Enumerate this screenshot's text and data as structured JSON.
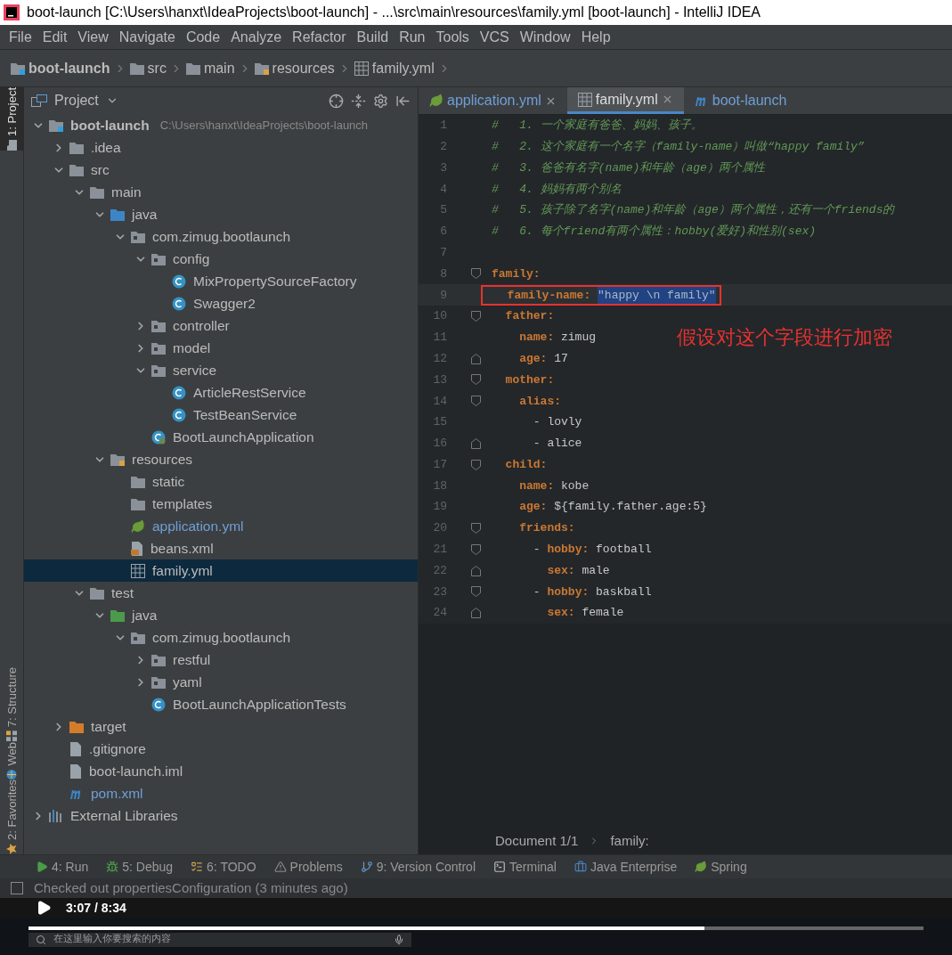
{
  "window": {
    "title": "boot-launch [C:\\Users\\hanxt\\IdeaProjects\\boot-launch] - ...\\src\\main\\resources\\family.yml [boot-launch] - IntelliJ IDEA"
  },
  "menu": [
    "File",
    "Edit",
    "View",
    "Navigate",
    "Code",
    "Analyze",
    "Refactor",
    "Build",
    "Run",
    "Tools",
    "VCS",
    "Window",
    "Help"
  ],
  "breadcrumbs": [
    {
      "label": "boot-launch",
      "kind": "module"
    },
    {
      "label": "src",
      "kind": "folder"
    },
    {
      "label": "main",
      "kind": "folder"
    },
    {
      "label": "resources",
      "kind": "resources"
    },
    {
      "label": "family.yml",
      "kind": "yml"
    }
  ],
  "tool_stripe": [
    {
      "label": "1: Project",
      "selected": true,
      "kind": "project"
    },
    {
      "label": "7: Structure",
      "selected": false,
      "kind": "structure"
    },
    {
      "label": "Web",
      "selected": false,
      "kind": "web"
    },
    {
      "label": "2: Favorites",
      "selected": false,
      "kind": "favorites"
    }
  ],
  "project_panel": {
    "title": "Project",
    "tree": [
      {
        "label": "boot-launch",
        "kind": "module",
        "path": "C:\\Users\\hanxt\\IdeaProjects\\boot-launch",
        "expanded": true,
        "selected": false,
        "children": [
          {
            "label": ".idea",
            "kind": "folder",
            "expanded": false,
            "selected": false
          },
          {
            "label": "src",
            "kind": "folder",
            "expanded": true,
            "selected": false,
            "children": [
              {
                "label": "main",
                "kind": "folder",
                "expanded": true,
                "selected": false,
                "children": [
                  {
                    "label": "java",
                    "kind": "source",
                    "expanded": true,
                    "selected": false,
                    "children": [
                      {
                        "label": "com.zimug.bootlaunch",
                        "kind": "package",
                        "expanded": true,
                        "selected": false,
                        "children": [
                          {
                            "label": "config",
                            "kind": "package",
                            "expanded": true,
                            "selected": false,
                            "children": [
                              {
                                "label": "MixPropertySourceFactory",
                                "kind": "class",
                                "selected": false
                              },
                              {
                                "label": "Swagger2",
                                "kind": "class",
                                "selected": false
                              }
                            ]
                          },
                          {
                            "label": "controller",
                            "kind": "package",
                            "expanded": false,
                            "selected": false
                          },
                          {
                            "label": "model",
                            "kind": "package",
                            "expanded": false,
                            "selected": false
                          },
                          {
                            "label": "service",
                            "kind": "package",
                            "expanded": true,
                            "selected": false,
                            "children": [
                              {
                                "label": "ArticleRestService",
                                "kind": "class",
                                "selected": false
                              },
                              {
                                "label": "TestBeanService",
                                "kind": "class",
                                "selected": false
                              }
                            ]
                          },
                          {
                            "label": "BootLaunchApplication",
                            "kind": "spring_class",
                            "selected": false
                          }
                        ]
                      }
                    ]
                  },
                  {
                    "label": "resources",
                    "kind": "resources",
                    "expanded": true,
                    "selected": false,
                    "children": [
                      {
                        "label": "static",
                        "kind": "folder",
                        "selected": false
                      },
                      {
                        "label": "templates",
                        "kind": "folder",
                        "selected": false
                      },
                      {
                        "label": "application.yml",
                        "kind": "spring_yml",
                        "modified": true,
                        "selected": false
                      },
                      {
                        "label": "beans.xml",
                        "kind": "xml",
                        "selected": false
                      },
                      {
                        "label": "family.yml",
                        "kind": "yml",
                        "selected": true
                      }
                    ]
                  }
                ]
              },
              {
                "label": "test",
                "kind": "folder",
                "expanded": true,
                "selected": false,
                "children": [
                  {
                    "label": "java",
                    "kind": "test_source",
                    "expanded": true,
                    "selected": false,
                    "children": [
                      {
                        "label": "com.zimug.bootlaunch",
                        "kind": "package",
                        "expanded": true,
                        "selected": false,
                        "children": [
                          {
                            "label": "restful",
                            "kind": "package",
                            "expanded": false,
                            "selected": false
                          },
                          {
                            "label": "yaml",
                            "kind": "package",
                            "expanded": false,
                            "selected": false
                          },
                          {
                            "label": "BootLaunchApplicationTests",
                            "kind": "class",
                            "selected": false
                          }
                        ]
                      }
                    ]
                  }
                ]
              }
            ]
          },
          {
            "label": "target",
            "kind": "excluded",
            "expanded": false,
            "selected": false
          },
          {
            "label": ".gitignore",
            "kind": "file",
            "selected": false
          },
          {
            "label": "boot-launch.iml",
            "kind": "file",
            "selected": false
          },
          {
            "label": "pom.xml",
            "kind": "maven",
            "modified": true,
            "selected": false
          }
        ]
      },
      {
        "label": "External Libraries",
        "kind": "library",
        "expanded": false,
        "selected": false
      }
    ]
  },
  "tabs": [
    {
      "label": "application.yml",
      "kind": "spring_yml",
      "selected": false,
      "closable": true
    },
    {
      "label": "family.yml",
      "kind": "yml",
      "selected": true,
      "closable": true
    },
    {
      "label": "boot-launch",
      "kind": "maven",
      "selected": false,
      "closable": false
    }
  ],
  "editor": {
    "lines": [
      {
        "number": "1",
        "boxed": false,
        "tokens": [
          {
            "kind": "comment",
            "text": "#   1. 一个家庭有爸爸、妈妈、孩子。"
          }
        ]
      },
      {
        "number": "2",
        "boxed": false,
        "tokens": [
          {
            "kind": "comment",
            "text": "#   2. 这个家庭有一个名字（family-name）叫做“happy family”"
          }
        ]
      },
      {
        "number": "3",
        "boxed": false,
        "tokens": [
          {
            "kind": "comment",
            "text": "#   3. 爸爸有名字(name)和年龄（age）两个属性"
          }
        ]
      },
      {
        "number": "4",
        "boxed": false,
        "tokens": [
          {
            "kind": "comment",
            "text": "#   4. 妈妈有两个别名"
          }
        ]
      },
      {
        "number": "5",
        "boxed": false,
        "tokens": [
          {
            "kind": "comment",
            "text": "#   5. 孩子除了名字(name)和年龄（age）两个属性，还有一个friends的"
          }
        ]
      },
      {
        "number": "6",
        "boxed": false,
        "tokens": [
          {
            "kind": "comment",
            "text": "#   6. 每个friend有两个属性：hobby(爱好)和性别(sex)"
          }
        ]
      },
      {
        "number": "7",
        "boxed": false
      },
      {
        "number": "8",
        "boxed": false,
        "kind": "fold_start",
        "tokens": [
          {
            "kind": "key",
            "text": "family:"
          }
        ]
      },
      {
        "number": "9",
        "boxed": true,
        "tokens": [
          {
            "kind": "key",
            "text": "  family-name: "
          },
          {
            "kind": "selection",
            "text": "\"happy \\n family\""
          }
        ]
      },
      {
        "number": "10",
        "boxed": false,
        "kind": "fold_start",
        "tokens": [
          {
            "kind": "key",
            "text": "  father:"
          }
        ]
      },
      {
        "number": "11",
        "boxed": false,
        "tokens": [
          {
            "kind": "key",
            "text": "    name: "
          },
          {
            "kind": "value",
            "text": "zimug"
          }
        ]
      },
      {
        "number": "12",
        "boxed": false,
        "kind": "fold_end",
        "tokens": [
          {
            "kind": "key",
            "text": "    age: "
          },
          {
            "kind": "value",
            "text": "17"
          }
        ]
      },
      {
        "number": "13",
        "boxed": false,
        "kind": "fold_start",
        "tokens": [
          {
            "kind": "key",
            "text": "  mother:"
          }
        ]
      },
      {
        "number": "14",
        "boxed": false,
        "kind": "fold_start",
        "tokens": [
          {
            "kind": "key",
            "text": "    alias:"
          }
        ]
      },
      {
        "number": "15",
        "boxed": false,
        "tokens": [
          {
            "kind": "value",
            "text": "      - lovly"
          }
        ]
      },
      {
        "number": "16",
        "boxed": false,
        "kind": "fold_end",
        "tokens": [
          {
            "kind": "value",
            "text": "      - alice"
          }
        ]
      },
      {
        "number": "17",
        "boxed": false,
        "kind": "fold_start",
        "tokens": [
          {
            "kind": "key",
            "text": "  child:"
          }
        ]
      },
      {
        "number": "18",
        "boxed": false,
        "tokens": [
          {
            "kind": "key",
            "text": "    name: "
          },
          {
            "kind": "value",
            "text": "kobe"
          }
        ]
      },
      {
        "number": "19",
        "boxed": false,
        "tokens": [
          {
            "kind": "key",
            "text": "    age: "
          },
          {
            "kind": "value",
            "text": "${family.father.age:5}"
          }
        ]
      },
      {
        "number": "20",
        "boxed": false,
        "kind": "fold_start",
        "tokens": [
          {
            "kind": "key",
            "text": "    friends:"
          }
        ]
      },
      {
        "number": "21",
        "boxed": false,
        "kind": "fold_start",
        "tokens": [
          {
            "kind": "value",
            "text": "      - "
          },
          {
            "kind": "key",
            "text": "hobby: "
          },
          {
            "kind": "value",
            "text": "football"
          }
        ]
      },
      {
        "number": "22",
        "boxed": false,
        "kind": "fold_end",
        "tokens": [
          {
            "kind": "key",
            "text": "        sex: "
          },
          {
            "kind": "value",
            "text": "male"
          }
        ]
      },
      {
        "number": "23",
        "boxed": false,
        "kind": "fold_start",
        "tokens": [
          {
            "kind": "value",
            "text": "      - "
          },
          {
            "kind": "key",
            "text": "hobby: "
          },
          {
            "kind": "value",
            "text": "baskball"
          }
        ]
      },
      {
        "number": "24",
        "boxed": false,
        "kind": "fold_end",
        "tokens": [
          {
            "kind": "key",
            "text": "        sex: "
          },
          {
            "kind": "value",
            "text": "female"
          }
        ]
      }
    ],
    "annotation": "假设对这个字段进行加密",
    "breadcrumb": [
      "Document 1/1",
      "family:"
    ]
  },
  "tool_buttons": [
    {
      "label": "4: Run",
      "kind": "run"
    },
    {
      "label": "5: Debug",
      "kind": "debug"
    },
    {
      "label": "6: TODO",
      "kind": "todo"
    },
    {
      "label": "Problems",
      "kind": "problems"
    },
    {
      "label": "9: Version Control",
      "kind": "vcs"
    },
    {
      "label": "Terminal",
      "kind": "terminal"
    },
    {
      "label": "Java Enterprise",
      "kind": "enterprise"
    },
    {
      "label": "Spring",
      "kind": "spring"
    }
  ],
  "status": "Checked out propertiesConfiguration (3 minutes ago)",
  "video": {
    "time": "3:07 / 8:34",
    "level": 0.755
  },
  "taskbar": {
    "search_placeholder": "在这里输入你要搜索的内容"
  }
}
